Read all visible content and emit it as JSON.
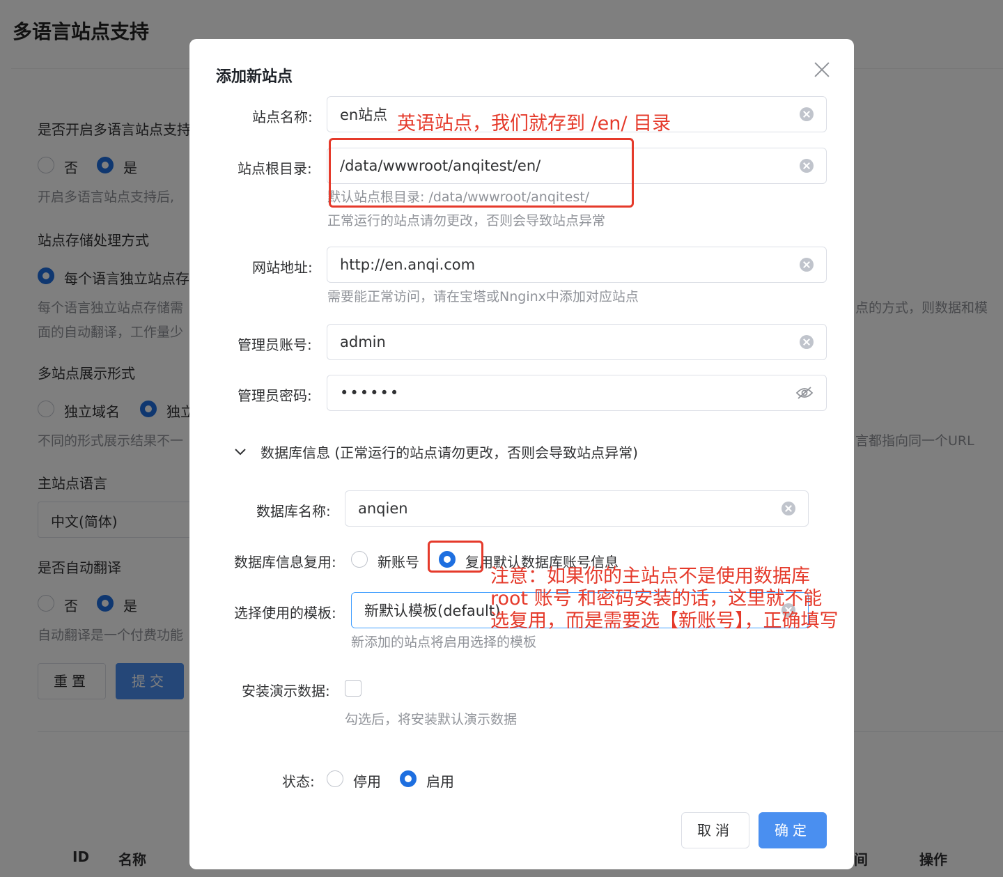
{
  "background": {
    "page_title": "多语言站点支持",
    "enable_label": "是否开启多语言站点支持",
    "enable_no": "否",
    "enable_yes": "是",
    "enable_help": "开启多语言站点支持后,",
    "storage_label": "站点存储处理方式",
    "storage_option": "每个语言独立站点存",
    "storage_help_1": "每个语言独立站点存储需",
    "storage_help_2": "面的自动翻译，工作量少",
    "storage_help_right": "点的方式，则数据和模",
    "display_label": "多站点展示形式",
    "display_opt1": "独立域名",
    "display_opt2": "独立",
    "display_help": "不同的形式展示结果不一",
    "display_help_right": "言都指向同一个URL",
    "main_lang_label": "主站点语言",
    "main_lang_value": "中文(简体)",
    "auto_translate_label": "是否自动翻译",
    "auto_no": "否",
    "auto_yes": "是",
    "auto_help": "自动翻译是一个付费功能",
    "reset_btn": "重置",
    "submit_btn": "提交",
    "th_id": "ID",
    "th_name": "名称",
    "th_time": "间",
    "th_action": "操作"
  },
  "dialog": {
    "title": "添加新站点",
    "site_name_label": "站点名称:",
    "site_name_value": "en站点",
    "root_label": "站点根目录:",
    "root_value": "/data/wwwroot/anqitest/en/",
    "root_help_1": "默认站点根目录: /data/wwwroot/anqitest/",
    "root_help_2": "正常运行的站点请勿更改，否则会导致站点异常",
    "url_label": "网站地址:",
    "url_value": "http://en.anqi.com",
    "url_help": "需要能正常访问，请在宝塔或Nnginx中添加对应站点",
    "admin_label": "管理员账号:",
    "admin_value": "admin",
    "password_label": "管理员密码:",
    "password_value": "••••••",
    "db_section": "数据库信息 (正常运行的站点请勿更改，否则会导致站点异常)",
    "db_name_label": "数据库名称:",
    "db_name_value": "anqien",
    "db_reuse_label": "数据库信息复用:",
    "db_reuse_new": "新账号",
    "db_reuse_default": "复用默认数据库账号信息",
    "template_label": "选择使用的模板:",
    "template_value": "新默认模板(default)",
    "template_help": "新添加的站点将启用选择的模板",
    "demo_label": "安装演示数据:",
    "demo_help": "勾选后，将安装默认演示数据",
    "status_label": "状态:",
    "status_off": "停用",
    "status_on": "启用",
    "cancel_btn": "取消",
    "ok_btn": "确定"
  },
  "annotations": {
    "note_1": "英语站点，我们就存到 /en/ 目录",
    "note_2_line1": "注意：如果你的主站点不是使用数据库",
    "note_2_line2": "root 账号 和密码安装的话，这里就不能",
    "note_2_line3": "选复用，而是需要选【新账号】，正确填写"
  },
  "colors": {
    "primary": "#4a8ff0",
    "radio_checked": "#1e6fe0",
    "annotation_red": "#e53a2b",
    "overlay": "rgba(0,0,0,0.5)"
  }
}
